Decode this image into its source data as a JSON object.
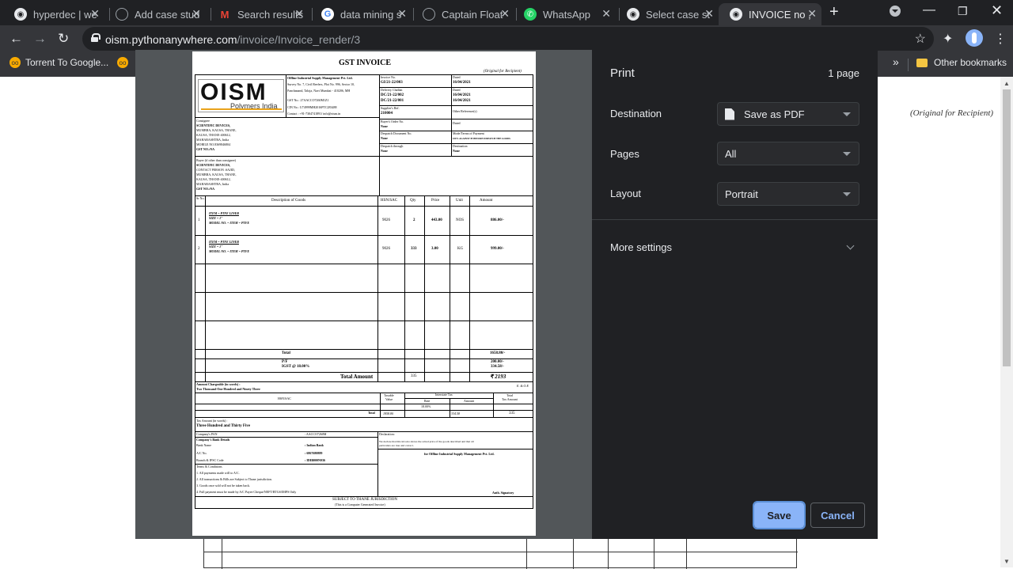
{
  "tabs": [
    {
      "title": "hyperdec | we",
      "icon": "chrome-icon"
    },
    {
      "title": "Add case stud",
      "icon": "globe-icon"
    },
    {
      "title": "Search results",
      "icon": "gmail-icon"
    },
    {
      "title": "data mining s",
      "icon": "google-icon"
    },
    {
      "title": "Captain Float",
      "icon": "globe-icon"
    },
    {
      "title": "WhatsApp",
      "icon": "whatsapp-icon"
    },
    {
      "title": "Select case st",
      "icon": "chrome-icon"
    },
    {
      "title": "INVOICE no ,",
      "icon": "chrome-icon",
      "active": true
    }
  ],
  "url": {
    "host": "oism.pythonanywhere.com",
    "path": "/invoice/Invoice_render/3"
  },
  "bookmarks": {
    "first": "Torrent To Google...",
    "other": "Other bookmarks"
  },
  "background": {
    "original_label": "(Original for Recipient)"
  },
  "print": {
    "title": "Print",
    "page_count": "1 page",
    "destination_label": "Destination",
    "destination_value": "Save as PDF",
    "pages_label": "Pages",
    "pages_value": "All",
    "layout_label": "Layout",
    "layout_value": "Portrait",
    "more_settings": "More settings",
    "save": "Save",
    "cancel": "Cancel"
  },
  "invoice": {
    "title": "GST INVOICE",
    "original": "(Original for Recipient)",
    "logo_text": "OISM",
    "logo_sub": "Polymers India",
    "company": "Offline Industrial Supply Management Pvt. Ltd.",
    "company_addr": "Survey No. 7, Civil Reefers, Plot No. 996, Sector 10,",
    "company_addr2": "Panchanand, Taloja, Navi Mumbai - 410206, MH",
    "company_gst": "GST No.: 27AACCO7260M1Z1",
    "company_cin": "CIN No.: U74999MH2016PTC283488",
    "company_contact": "Contact : +91-7304741891/ info@oism.in",
    "invoice_no_label": "Invoice No.",
    "invoice_no": "GI/21-22/003",
    "dated_label": "Dated",
    "dated": "16/04/2021",
    "challan_label": "Delivery Challan",
    "challan1": "DC/21-22/002",
    "challan2": "DC/21-22/001",
    "challan_date1": "16/04/2021",
    "challan_date2": "16/04/2021",
    "supplier_ref_label": "Supplier's Ref.",
    "supplier_ref": "210004",
    "other_ref_label": "Other Reference(s)",
    "consignee_label": "Consignee",
    "consignee": [
      "SCIENTIFIC DEVICES,",
      "MUMBRA, KAUSA, THANE,",
      "KAUSA, THANE-400612,",
      "MAHARASHTRA, India",
      "MOBILE NO.8369846804",
      "GST NO.:NA"
    ],
    "buyer_order_label": "Buyer's Order No.",
    "buyer_order": "None",
    "buyer_dated": "Dated",
    "despatch_doc_label": "Despatch Document No.",
    "despatch_doc": "None",
    "terms_label": "Mode/Terms of Payment",
    "terms": "100% AGAINST PI BEFORE DISPATCH THE GOODS",
    "despatch_through_label": "Despatch through",
    "despatch_through": "None",
    "destination_label": "Destination",
    "destination": "None",
    "buyer_label": "Buyer (if other than consignee)",
    "buyer": [
      "SCIENTIFIC DEVICES,",
      "CONTACT PERSON :SAJID,",
      "MUMBRA, KAUSA, THANE,",
      "KAUSA, THANE-400612,",
      "MAHARASHTRA, India",
      "GST NO.:NA"
    ],
    "col_sr": "Sr No.",
    "col_desc": "Description of Goods",
    "col_hsn": "HSN/SAC",
    "col_qty": "Qty",
    "col_price": "Price",
    "col_unit": "Unit",
    "col_amount": "Amount",
    "items": [
      {
        "sr": "1",
        "item": "ITEM = PTFE LINER",
        "size": "SIZE = 1\"",
        "model": "MODEL NO. = ITEM = PTFE",
        "hsn": "9026",
        "qty": "2",
        "price": "443.00",
        "unit": "NOS",
        "amount": "886.00/-"
      },
      {
        "sr": "2",
        "item": "ITEM = PTFE LINER",
        "size": "SIZE = 1\"",
        "model": "MODEL NO. = ITEM = PTFE",
        "hsn": "9026",
        "qty": "333",
        "price": "3.00",
        "unit": "KG",
        "amount": "999.00/-"
      }
    ],
    "total_label": "Total",
    "total": "1658.80/-",
    "pf_label": "P/F",
    "pf": "200.00/-",
    "igst_label": "IGST @ 18.00%",
    "igst": "334.58/-",
    "total_amount_label": "Total Amount",
    "total_qty": "335",
    "total_amount": "₹ 2193",
    "chargeable_label": "Amount Chargeable (in words) :",
    "chargeable_words": "Two Thousand One Hundred and Ninety Three",
    "eoe": "E. & O.E",
    "tax_hsn": "HSN/SAC",
    "taxable": "Taxable",
    "taxable2": "Value",
    "interstate": "Interstate Tax",
    "rate": "Rate",
    "amount": "Amount",
    "total_tax": "Total",
    "total_tax2": "Tax Amount",
    "rate_val": "18.00%",
    "tax_total_label": "Total",
    "taxable_val": "1858.80",
    "tax_amt": "334.58",
    "total_tax_val": "335",
    "tax_words_label": "Tax Amount (in words) :",
    "tax_words": "Three Hundred and Thirty Five",
    "pan_label": "Company's PAN",
    "pan": ": AACCO7260M",
    "bank_label": "Company's Bank Details",
    "bank_name_label": "Bank Name",
    "bank_name": ": Indian Bank",
    "acno_label": "A/C No.",
    "acno": ": 6867680889",
    "ifsc_label": "Branch & IFSC Code",
    "ifsc": ": IDIB000N036",
    "tc_label": "Terms & Conditions",
    "tc": [
      "1. All payments made will to A/C.",
      "2. All transactions & Bills are Subject to Thane jurisdiction.",
      "3. Goods once sold will not be taken back.",
      "4. Full payment must be made by A/C Payee Cheque/NEFT/RTGS/IMPS Only"
    ],
    "declaration_label": "Declaration:",
    "declaration": "We declare that this invoice shows the actual price of the goods described and that all",
    "declaration2": "particulars are true and correct.",
    "for_company": "for Offline Industrial Supply Management Pvt. Ltd.",
    "signatory": "Auth. Signatory",
    "jurisdiction": "SUBJECT TO THANE JURISDICTION",
    "computer_gen": "(This is a Computer Generated Invoice)"
  }
}
